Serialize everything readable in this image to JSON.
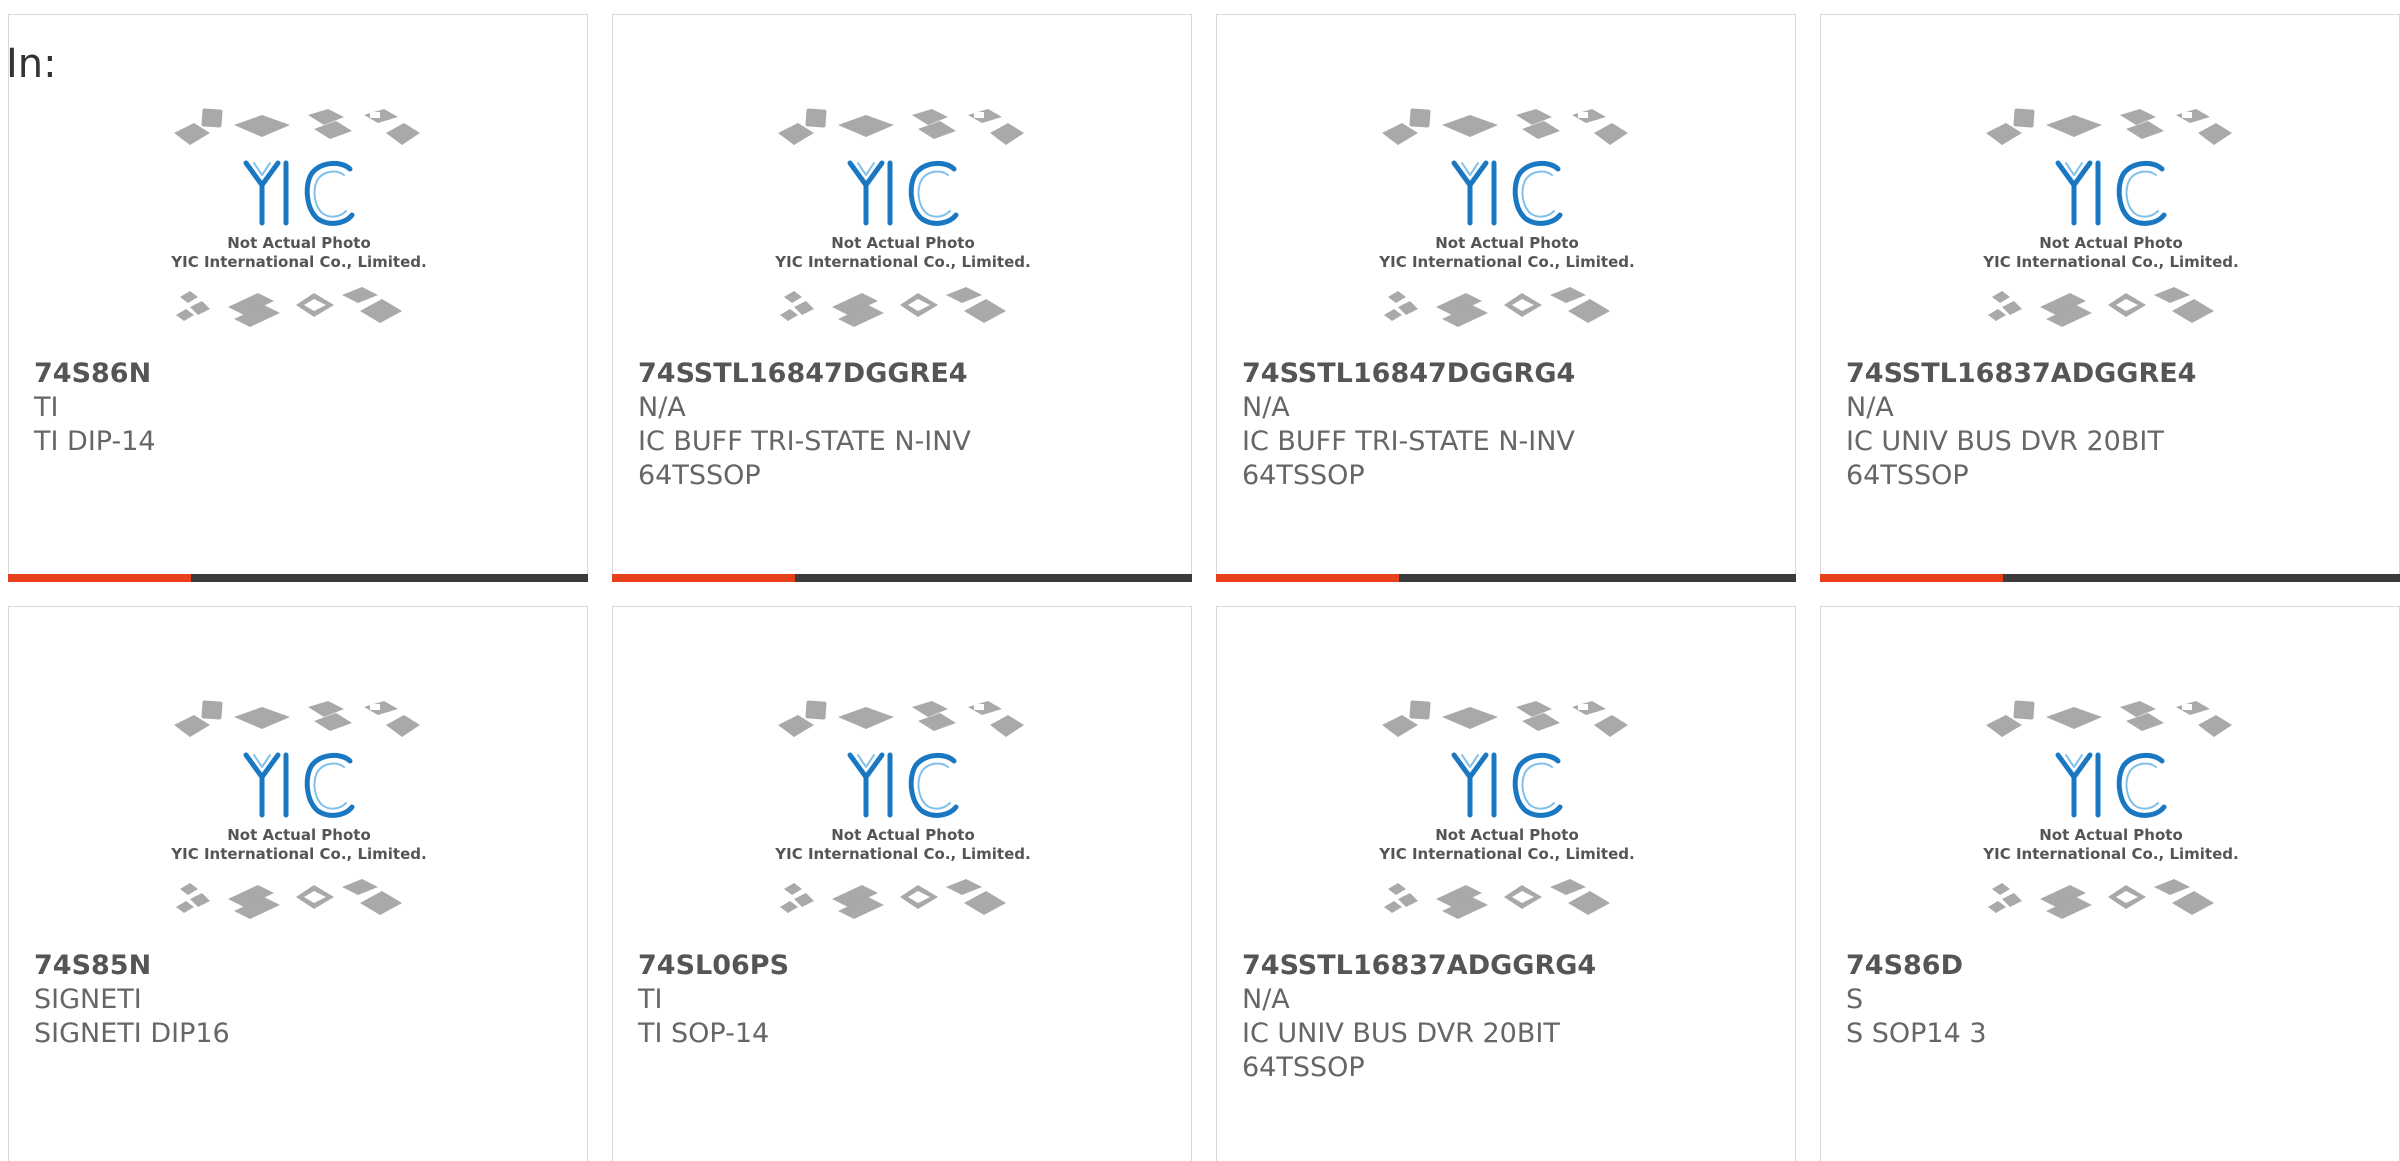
{
  "header": {
    "label": "In:"
  },
  "colors": {
    "accent": "#e8401c",
    "bar_dark": "#3c3c3c",
    "logo_blue": "#1a78c2"
  },
  "placeholder": {
    "logo_text": "YIC",
    "caption_line1": "Not Actual Photo",
    "caption_line2": "YIC International Co., Limited."
  },
  "products": [
    {
      "part": "74S86N",
      "lines": [
        "TI",
        "TI DIP-14"
      ]
    },
    {
      "part": "74SSTL16847DGGRE4",
      "lines": [
        "N/A",
        "IC BUFF TRI-STATE N-INV",
        "64TSSOP"
      ]
    },
    {
      "part": "74SSTL16847DGGRG4",
      "lines": [
        "N/A",
        "IC BUFF TRI-STATE N-INV",
        "64TSSOP"
      ]
    },
    {
      "part": "74SSTL16837ADGGRE4",
      "lines": [
        "N/A",
        "IC UNIV BUS DVR 20BIT",
        "64TSSOP"
      ]
    },
    {
      "part": "74S85N",
      "lines": [
        "SIGNETI",
        "SIGNETI DIP16"
      ]
    },
    {
      "part": "74SL06PS",
      "lines": [
        "TI",
        "TI SOP-14"
      ]
    },
    {
      "part": "74SSTL16837ADGGRG4",
      "lines": [
        "N/A",
        "IC UNIV BUS DVR 20BIT",
        "64TSSOP"
      ]
    },
    {
      "part": "74S86D",
      "lines": [
        "S",
        "S SOP14 3"
      ]
    }
  ]
}
